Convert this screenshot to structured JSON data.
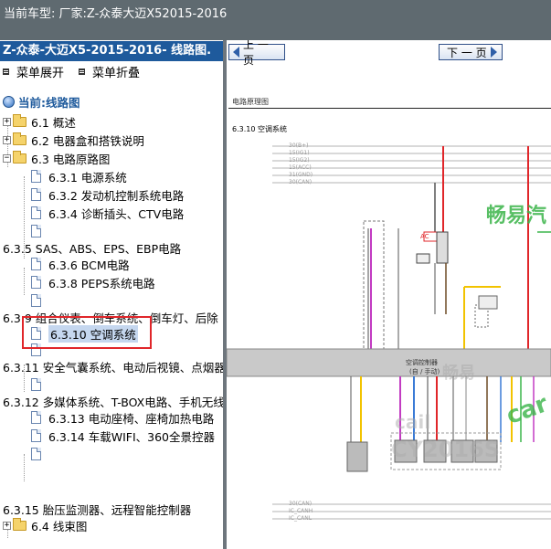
{
  "topbar": {
    "text": "当前车型:  厂家:Z-众泰大迈X52015-2016"
  },
  "left_panel": {
    "title": "Z-众泰-大迈X5-2015-2016- 线路图.",
    "expand_label": "菜单展开",
    "collapse_label": "菜单折叠",
    "current_label": "当前:线路图",
    "tree": [
      {
        "id": "n61",
        "label": "6.1 概述"
      },
      {
        "id": "n62",
        "label": "6.2 电器盒和搭铁说明"
      },
      {
        "id": "n63",
        "label": "6.3 电路原路图"
      },
      {
        "id": "n631",
        "label": "6.3.1 电源系统"
      },
      {
        "id": "n632",
        "label": "6.3.2 发动机控制系统电路"
      },
      {
        "id": "n634",
        "label": "6.3.4 诊断插头、CTV电路"
      },
      {
        "id": "n635",
        "label": "6.3.5 SAS、ABS、EPS、EBP电路"
      },
      {
        "id": "n636",
        "label": "6.3.6 BCM电路"
      },
      {
        "id": "n638",
        "label": "6.3.8 PEPS系统电路"
      },
      {
        "id": "n639",
        "label": "6.3.9 组合仪表、倒车系统、倒车灯、后除"
      },
      {
        "id": "n6310",
        "label": "6.3.10 空调系统"
      },
      {
        "id": "n6311",
        "label": "6.3.11 安全气囊系统、电动后视镜、点烟器"
      },
      {
        "id": "n6312",
        "label": "6.3.12 多媒体系统、T-BOX电路、手机无线"
      },
      {
        "id": "n6313",
        "label": "6.3.13 电动座椅、座椅加热电路"
      },
      {
        "id": "n6314",
        "label": "6.3.14 车载WIFI、360全景控器"
      },
      {
        "id": "n6315",
        "label": "6.3.15 胎压监测器、远程智能控制器"
      },
      {
        "id": "n64",
        "label": "6.4 线束图"
      }
    ]
  },
  "right_panel": {
    "prev_label": "上 一 页",
    "next_label": "下 一 页",
    "doc_header": "电路原理图",
    "section_title": "6.3.10 空调系统",
    "watermark_1": "畅易汽",
    "watermark_2": "cail",
    "watermark_3": "CY2016S",
    "watermark_4": "car",
    "watermark_5": "畅易",
    "ac_label": "AC",
    "bus_label": "空调控制器",
    "bus_sub": "(自 / 手动)",
    "left_labels": [
      "30(B+)",
      "15(IG1)",
      "15(IG2)",
      "15(ACC)",
      "31(GND)",
      "30(CAN)"
    ],
    "bottom_labels": [
      "30(CAN)",
      "IC_CANH",
      "IC_CANL"
    ]
  },
  "colors": {
    "topbar_bg": "#5f6a70",
    "title_bg": "#1e5a9c",
    "highlight_border": "#e0262a",
    "watermark_green": "#3bb54a"
  }
}
